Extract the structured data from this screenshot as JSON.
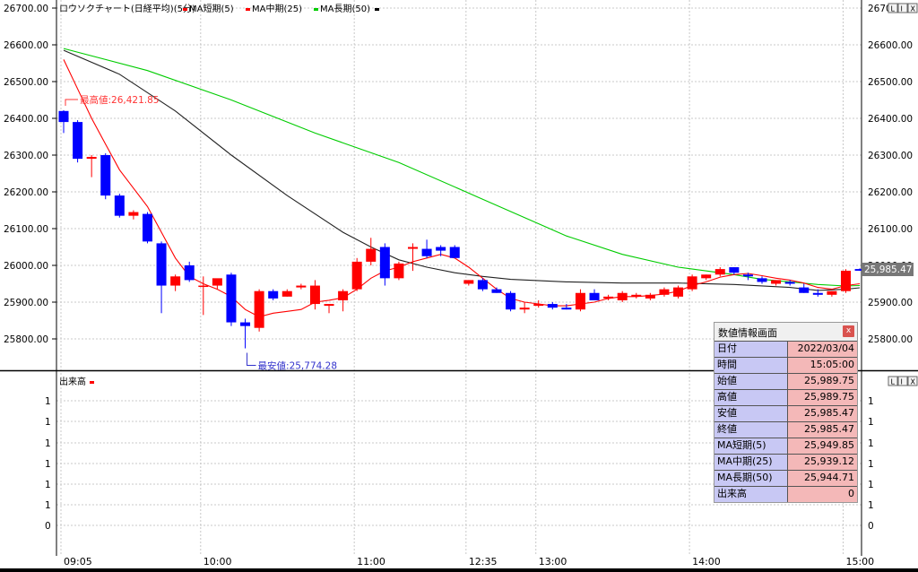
{
  "header": {
    "title": "ロウソクチャート(日経平均)(5分)",
    "legend": [
      {
        "label": "MA短期(5)",
        "color": "#ff0000"
      },
      {
        "label": "MA中期(25)",
        "color": "#ff0000"
      },
      {
        "label": "MA長期(50)",
        "color": "#00cc00"
      }
    ],
    "volume_title": "出来高"
  },
  "buttons": [
    "L",
    "I",
    "X"
  ],
  "chart_data": {
    "type": "candlestick",
    "x_ticks": [
      "09:05",
      "10:00",
      "11:00",
      "12:35",
      "13:00",
      "14:00",
      "15:00"
    ],
    "y_ticks": [
      "26700.00",
      "26600.00",
      "26500.00",
      "26400.00",
      "26300.00",
      "26200.00",
      "26100.00",
      "26000.00",
      "25900.00",
      "25800.00"
    ],
    "ylim": [
      25700,
      26700
    ],
    "last_value_label": "25,985.47",
    "candles": [
      [
        26420,
        26421.85,
        26360,
        26390
      ],
      [
        26390,
        26395,
        26280,
        26290
      ],
      [
        26290,
        26300,
        26240,
        26295
      ],
      [
        26300,
        26305,
        26180,
        26190
      ],
      [
        26190,
        26195,
        26130,
        26135
      ],
      [
        26135,
        26150,
        26125,
        26145
      ],
      [
        26140,
        26145,
        26060,
        26065
      ],
      [
        26060,
        26065,
        25870,
        25945
      ],
      [
        25945,
        25975,
        25930,
        25970
      ],
      [
        26000,
        26010,
        25955,
        25960
      ],
      [
        25945,
        25970,
        25865,
        25945
      ],
      [
        25945,
        25960,
        25935,
        25965
      ],
      [
        25975,
        25980,
        25835,
        25845
      ],
      [
        25845,
        25855,
        25774.28,
        25835
      ],
      [
        25830,
        25935,
        25820,
        25930
      ],
      [
        25930,
        25935,
        25905,
        25910
      ],
      [
        25915,
        25935,
        25915,
        25930
      ],
      [
        25940,
        25950,
        25935,
        25945
      ],
      [
        25895,
        25960,
        25880,
        25945
      ],
      [
        25890,
        25895,
        25870,
        25895
      ],
      [
        25905,
        25935,
        25875,
        25930
      ],
      [
        25935,
        26020,
        25930,
        26010
      ],
      [
        26010,
        26075,
        26000,
        26045
      ],
      [
        26050,
        26060,
        25945,
        25965
      ],
      [
        25965,
        26010,
        25960,
        26005
      ],
      [
        26045,
        26060,
        25985,
        26050
      ],
      [
        26045,
        26070,
        26020,
        26025
      ],
      [
        26050,
        26055,
        26025,
        26040
      ],
      [
        26050,
        26055,
        26020,
        26020
      ],
      [
        25950,
        25960,
        25945,
        25960
      ],
      [
        25960,
        25965,
        25930,
        25935
      ],
      [
        25935,
        25940,
        25925,
        25925
      ],
      [
        25925,
        25930,
        25875,
        25880
      ],
      [
        25880,
        25900,
        25870,
        25885
      ],
      [
        25890,
        25905,
        25885,
        25895
      ],
      [
        25895,
        25900,
        25880,
        25885
      ],
      [
        25885,
        25895,
        25880,
        25880
      ],
      [
        25880,
        25935,
        25875,
        25925
      ],
      [
        25925,
        25935,
        25910,
        25905
      ],
      [
        25910,
        25920,
        25905,
        25915
      ],
      [
        25905,
        25930,
        25900,
        25925
      ],
      [
        25915,
        25925,
        25910,
        25920
      ],
      [
        25910,
        25925,
        25905,
        25920
      ],
      [
        25920,
        25940,
        25915,
        25935
      ],
      [
        25915,
        25945,
        25910,
        25940
      ],
      [
        25935,
        25975,
        25930,
        25970
      ],
      [
        25965,
        25975,
        25960,
        25975
      ],
      [
        25975,
        25995,
        25970,
        25990
      ],
      [
        25995,
        25995,
        25975,
        25980
      ],
      [
        25975,
        25980,
        25960,
        25970
      ],
      [
        25965,
        25970,
        25950,
        25955
      ],
      [
        25950,
        25960,
        25945,
        25960
      ],
      [
        25955,
        25960,
        25945,
        25950
      ],
      [
        25940,
        25950,
        25925,
        25925
      ],
      [
        25925,
        25935,
        25915,
        25920
      ],
      [
        25920,
        25930,
        25915,
        25930
      ],
      [
        25930,
        25989.75,
        25925,
        25985.47
      ],
      [
        25990,
        25992,
        25985,
        25985.47
      ]
    ],
    "ma_short": [
      [
        0,
        26560
      ],
      [
        1,
        26480
      ],
      [
        2,
        26400
      ],
      [
        3,
        26330
      ],
      [
        4,
        26260
      ],
      [
        5,
        26210
      ],
      [
        6,
        26160
      ],
      [
        7,
        26090
      ],
      [
        8,
        26020
      ],
      [
        9,
        25970
      ],
      [
        10,
        25950
      ],
      [
        11,
        25935
      ],
      [
        12,
        25915
      ],
      [
        13,
        25880
      ],
      [
        14,
        25860
      ],
      [
        15,
        25870
      ],
      [
        16,
        25875
      ],
      [
        17,
        25880
      ],
      [
        18,
        25900
      ],
      [
        19,
        25905
      ],
      [
        20,
        25912
      ],
      [
        21,
        25935
      ],
      [
        22,
        25965
      ],
      [
        23,
        25985
      ],
      [
        24,
        25995
      ],
      [
        25,
        26010
      ],
      [
        26,
        26020
      ],
      [
        27,
        26030
      ],
      [
        28,
        26020
      ],
      [
        29,
        25995
      ],
      [
        30,
        25965
      ],
      [
        31,
        25935
      ],
      [
        32,
        25910
      ],
      [
        33,
        25900
      ],
      [
        34,
        25895
      ],
      [
        35,
        25890
      ],
      [
        36,
        25890
      ],
      [
        37,
        25895
      ],
      [
        38,
        25900
      ],
      [
        39,
        25910
      ],
      [
        40,
        25915
      ],
      [
        41,
        25915
      ],
      [
        42,
        25918
      ],
      [
        43,
        25922
      ],
      [
        44,
        25930
      ],
      [
        45,
        25945
      ],
      [
        46,
        25955
      ],
      [
        47,
        25968
      ],
      [
        48,
        25975
      ],
      [
        49,
        25978
      ],
      [
        50,
        25972
      ],
      [
        51,
        25965
      ],
      [
        52,
        25960
      ],
      [
        53,
        25952
      ],
      [
        54,
        25940
      ],
      [
        55,
        25935
      ],
      [
        56,
        25945
      ],
      [
        57,
        25950
      ]
    ],
    "ma_mid": [
      [
        0,
        26585
      ],
      [
        4,
        26520
      ],
      [
        8,
        26420
      ],
      [
        12,
        26300
      ],
      [
        16,
        26190
      ],
      [
        20,
        26090
      ],
      [
        22,
        26050
      ],
      [
        24,
        26015
      ],
      [
        26,
        25995
      ],
      [
        28,
        25980
      ],
      [
        30,
        25970
      ],
      [
        32,
        25962
      ],
      [
        36,
        25955
      ],
      [
        40,
        25952
      ],
      [
        44,
        25952
      ],
      [
        48,
        25948
      ],
      [
        52,
        25940
      ],
      [
        54,
        25932
      ],
      [
        56,
        25935
      ],
      [
        57,
        25939
      ]
    ],
    "ma_long": [
      [
        0,
        26590
      ],
      [
        6,
        26530
      ],
      [
        12,
        26450
      ],
      [
        18,
        26360
      ],
      [
        24,
        26280
      ],
      [
        30,
        26180
      ],
      [
        36,
        26080
      ],
      [
        40,
        26030
      ],
      [
        44,
        25995
      ],
      [
        48,
        25975
      ],
      [
        50,
        25962
      ],
      [
        52,
        25955
      ],
      [
        54,
        25948
      ],
      [
        56,
        25944
      ],
      [
        57,
        25945
      ]
    ],
    "annotations": {
      "high": {
        "label": "最高値:26,421.85",
        "value": 26421.85,
        "index": 0
      },
      "low": {
        "label": "最安値:25,774.28",
        "value": 25774.28,
        "index": 13
      }
    },
    "volume": {
      "y_ticks": [
        "1",
        "1",
        "1",
        "1",
        "1",
        "1",
        "1",
        "0"
      ]
    }
  },
  "info_panel": {
    "title": "数値情報画面",
    "close_label": "x",
    "rows": [
      {
        "label": "日付",
        "value": "2022/03/04"
      },
      {
        "label": "時間",
        "value": "15:05:00"
      },
      {
        "label": "始値",
        "value": "25,989.75"
      },
      {
        "label": "高値",
        "value": "25,989.75"
      },
      {
        "label": "安値",
        "value": "25,985.47"
      },
      {
        "label": "終値",
        "value": "25,985.47"
      },
      {
        "label": "MA短期(5)",
        "value": "25,949.85"
      },
      {
        "label": "MA中期(25)",
        "value": "25,939.12"
      },
      {
        "label": "MA長期(50)",
        "value": "25,944.71"
      },
      {
        "label": "出来高",
        "value": "0"
      }
    ]
  },
  "colors": {
    "up": "#ff0000",
    "down": "#0000ff",
    "ma_short": "#ff0000",
    "ma_mid": "#222222",
    "ma_long": "#00cc00"
  }
}
